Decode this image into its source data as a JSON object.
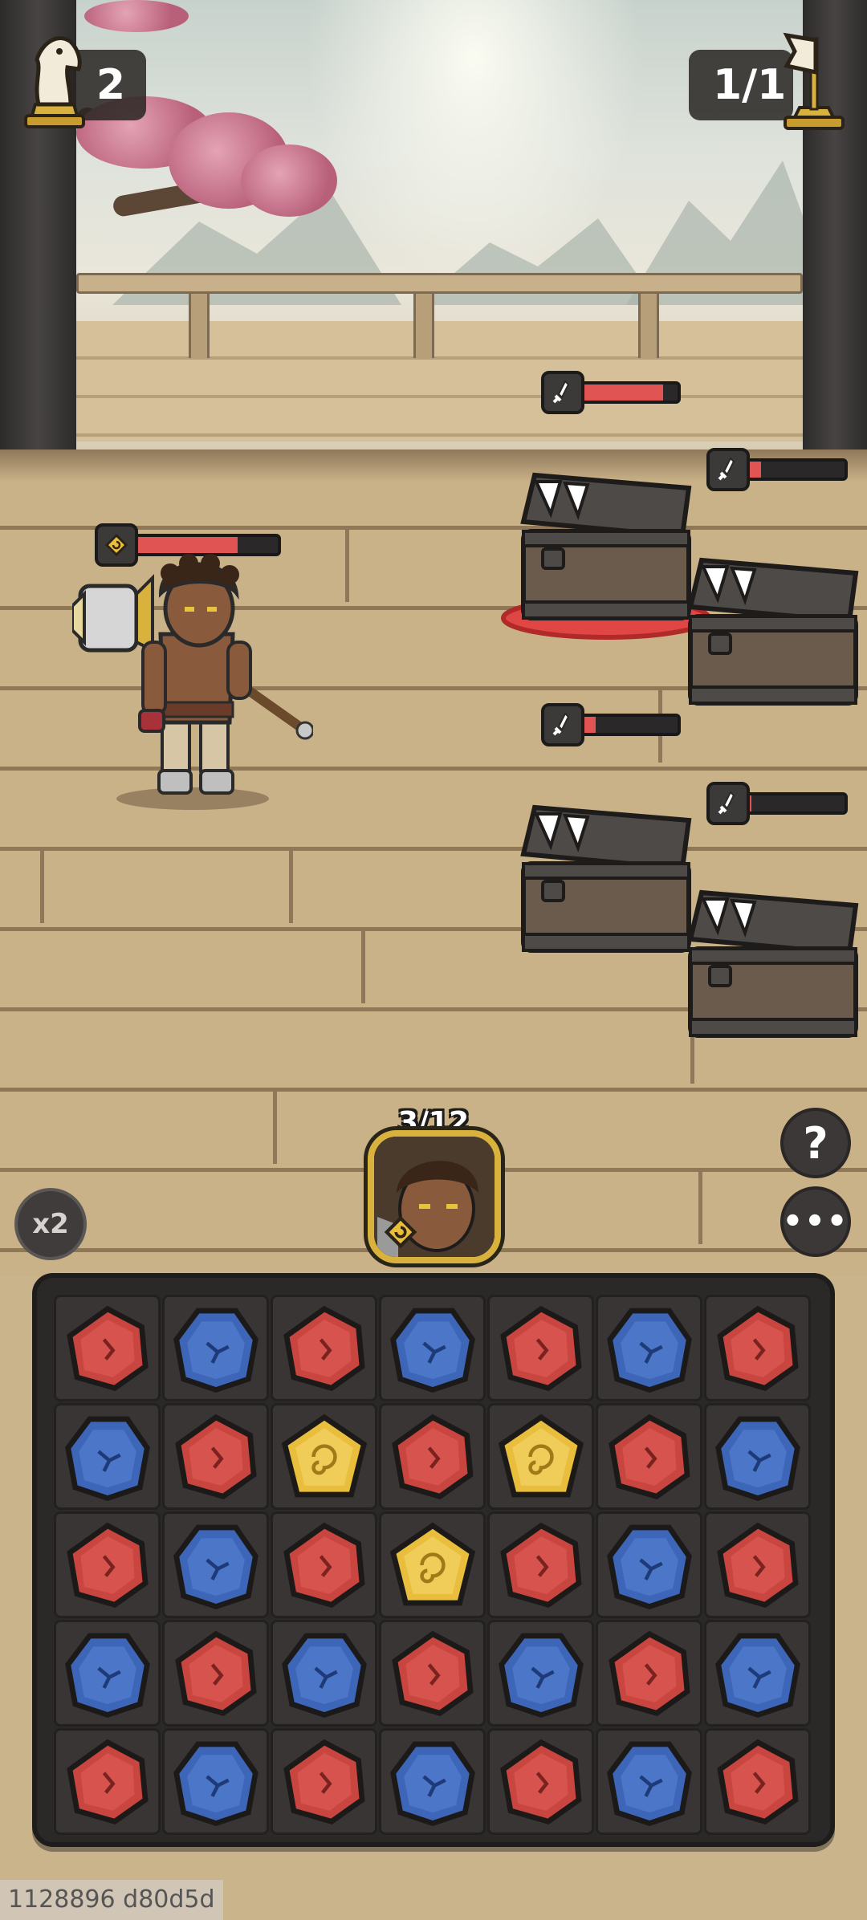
{
  "hud": {
    "moves_left": "2",
    "wave": "1/1"
  },
  "hero": {
    "name_icon": "spiral-element-icon",
    "hp_fraction": 0.72
  },
  "enemies": [
    {
      "name": "chest-mimic-1",
      "hp_fraction": 0.85,
      "targeted": true
    },
    {
      "name": "chest-mimic-2",
      "hp_fraction": 0.15,
      "targeted": false
    },
    {
      "name": "chest-mimic-3",
      "hp_fraction": 0.15,
      "targeted": false
    },
    {
      "name": "chest-mimic-4",
      "hp_fraction": 0.05,
      "targeted": false
    }
  ],
  "skill": {
    "charge": "3/12"
  },
  "controls": {
    "speed_label": "x2",
    "help_label": "?",
    "more_label": "•••"
  },
  "board": {
    "rows": [
      [
        "red",
        "blue",
        "red",
        "blue",
        "red",
        "blue",
        "red"
      ],
      [
        "blue",
        "red",
        "yellow",
        "red",
        "yellow",
        "red",
        "blue"
      ],
      [
        "red",
        "blue",
        "red",
        "yellow",
        "red",
        "blue",
        "red"
      ],
      [
        "blue",
        "red",
        "blue",
        "red",
        "blue",
        "red",
        "blue"
      ],
      [
        "red",
        "blue",
        "red",
        "blue",
        "red",
        "blue",
        "red"
      ]
    ]
  },
  "colors": {
    "red": "#c9453f",
    "blue": "#3d66b8",
    "yellow": "#e8be3c",
    "hp": "#e05554",
    "gold": "#d9b23d"
  },
  "footer": {
    "build": "1128896 d80d5d"
  }
}
